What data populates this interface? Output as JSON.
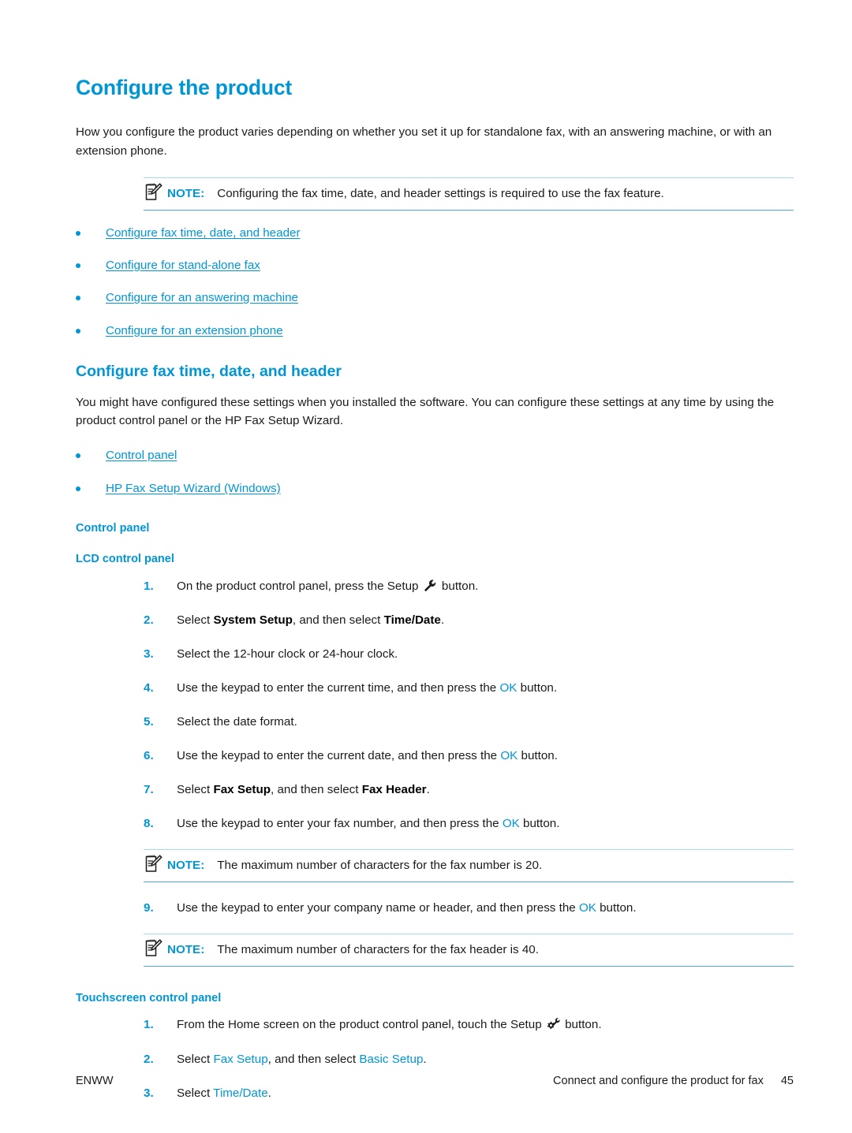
{
  "document": {
    "title": "Configure the product",
    "intro": "How you configure the product varies depending on whether you set it up for standalone fax, with an answering machine, or with an extension phone.",
    "note_label": "NOTE:",
    "intro_note": "Configuring the fax time, date, and header settings is required to use the fax feature.",
    "toc_links": [
      {
        "label": "Configure fax time, date, and header"
      },
      {
        "label": "Configure for stand-alone fax"
      },
      {
        "label": "Configure for an answering machine"
      },
      {
        "label": "Configure for an extension phone"
      }
    ]
  },
  "section": {
    "heading": "Configure fax time, date, and header",
    "paragraph": "You might have configured these settings when you installed the software. You can configure these settings at any time by using the product control panel or the HP Fax Setup Wizard.",
    "links": [
      {
        "label": "Control panel"
      },
      {
        "label": "HP Fax Setup Wizard (Windows)"
      }
    ],
    "control_panel_heading": "Control panel",
    "lcd_heading": "LCD control panel",
    "touchscreen_heading": "Touchscreen control panel"
  },
  "lcd_steps": [
    {
      "num": "1.",
      "parts": [
        {
          "t": "text",
          "v": "On the product control panel, press the Setup "
        },
        {
          "t": "icon",
          "v": "wrench-icon"
        },
        {
          "t": "text",
          "v": " button."
        }
      ]
    },
    {
      "num": "2.",
      "parts": [
        {
          "t": "text",
          "v": "Select "
        },
        {
          "t": "bold",
          "v": "System Setup"
        },
        {
          "t": "text",
          "v": ", and then select "
        },
        {
          "t": "bold",
          "v": "Time/Date"
        },
        {
          "t": "text",
          "v": "."
        }
      ]
    },
    {
      "num": "3.",
      "parts": [
        {
          "t": "text",
          "v": "Select the 12-hour clock or 24-hour clock."
        }
      ]
    },
    {
      "num": "4.",
      "parts": [
        {
          "t": "text",
          "v": "Use the keypad to enter the current time, and then press the "
        },
        {
          "t": "blue",
          "v": "OK"
        },
        {
          "t": "text",
          "v": " button."
        }
      ]
    },
    {
      "num": "5.",
      "parts": [
        {
          "t": "text",
          "v": "Select the date format."
        }
      ]
    },
    {
      "num": "6.",
      "parts": [
        {
          "t": "text",
          "v": "Use the keypad to enter the current date, and then press the "
        },
        {
          "t": "blue",
          "v": "OK"
        },
        {
          "t": "text",
          "v": " button."
        }
      ]
    },
    {
      "num": "7.",
      "parts": [
        {
          "t": "text",
          "v": "Select "
        },
        {
          "t": "bold",
          "v": "Fax Setup"
        },
        {
          "t": "text",
          "v": ", and then select "
        },
        {
          "t": "bold",
          "v": "Fax Header"
        },
        {
          "t": "text",
          "v": "."
        }
      ]
    },
    {
      "num": "8.",
      "parts": [
        {
          "t": "text",
          "v": "Use the keypad to enter your fax number, and then press the "
        },
        {
          "t": "blue",
          "v": "OK"
        },
        {
          "t": "text",
          "v": " button."
        }
      ]
    },
    {
      "num": "note",
      "note_label": "NOTE:",
      "note_text": "The maximum number of characters for the fax number is 20."
    },
    {
      "num": "9.",
      "parts": [
        {
          "t": "text",
          "v": "Use the keypad to enter your company name or header, and then press the "
        },
        {
          "t": "blue",
          "v": "OK"
        },
        {
          "t": "text",
          "v": " button."
        }
      ]
    },
    {
      "num": "note",
      "note_label": "NOTE:",
      "note_text": "The maximum number of characters for the fax header is 40."
    }
  ],
  "touchscreen_steps": [
    {
      "num": "1.",
      "parts": [
        {
          "t": "text",
          "v": "From the Home screen on the product control panel, touch the Setup "
        },
        {
          "t": "icon",
          "v": "gear-wrench-icon"
        },
        {
          "t": "text",
          "v": " button."
        }
      ]
    },
    {
      "num": "2.",
      "parts": [
        {
          "t": "text",
          "v": "Select "
        },
        {
          "t": "blue",
          "v": "Fax Setup"
        },
        {
          "t": "text",
          "v": ", and then select "
        },
        {
          "t": "blue",
          "v": "Basic Setup"
        },
        {
          "t": "text",
          "v": "."
        }
      ]
    },
    {
      "num": "3.",
      "parts": [
        {
          "t": "text",
          "v": "Select "
        },
        {
          "t": "blue",
          "v": "Time/Date"
        },
        {
          "t": "text",
          "v": "."
        }
      ]
    }
  ],
  "footer": {
    "left": "ENWW",
    "running_head": "Connect and configure the product for fax",
    "page_number": "45"
  },
  "colors": {
    "accent": "#0096d6",
    "rule_top": "#a8d8ee",
    "rule_bottom": "#4aa8d8",
    "text": "#1a1a1a"
  }
}
